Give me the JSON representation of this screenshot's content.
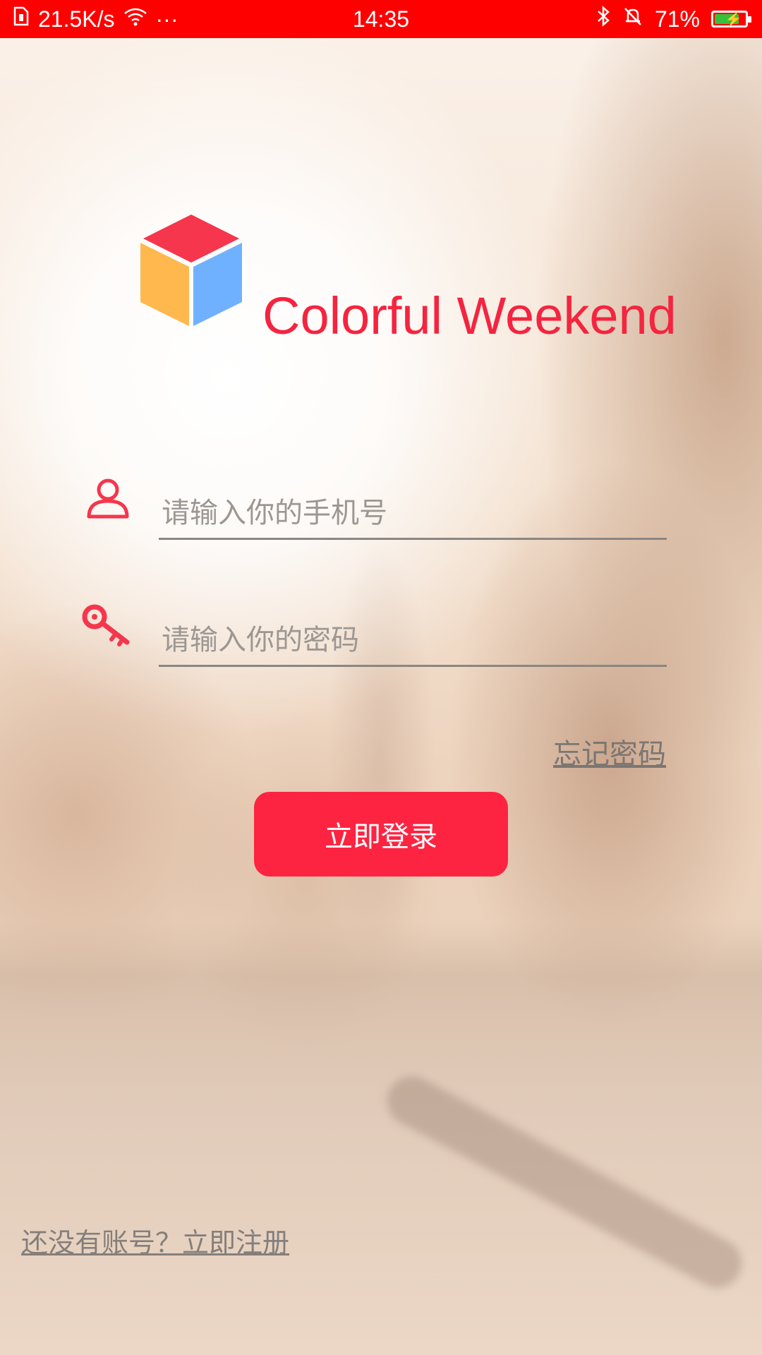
{
  "status_bar": {
    "net_speed": "21.5K/s",
    "more": "···",
    "time": "14:35",
    "battery": "71%",
    "battery_level": 0.71,
    "icons": [
      "sim-icon",
      "wifi-icon",
      "bluetooth-icon",
      "alarm-icon",
      "battery-icon"
    ]
  },
  "app": {
    "title": "Colorful Weekend",
    "logo_colors": {
      "top": "#f5364c",
      "left": "#ffb84d",
      "right": "#70b1ff"
    },
    "accent": "#fd2441"
  },
  "login": {
    "phone_placeholder": "请输入你的手机号",
    "password_placeholder": "请输入你的密码",
    "forgot_password": "忘记密码",
    "submit_label": "立即登录",
    "register_link": "还没有账号？立即注册",
    "icons": [
      "user-icon",
      "key-icon"
    ]
  }
}
